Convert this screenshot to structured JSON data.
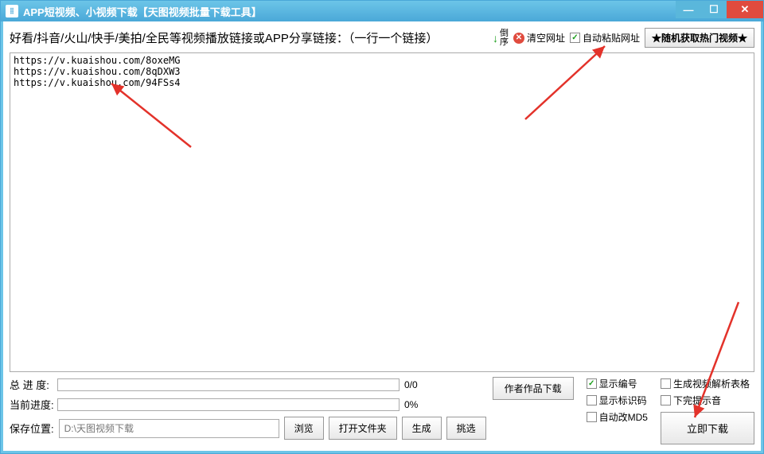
{
  "titlebar": {
    "icon": "⦙⦙",
    "text": "APP短视频、小视频下载【天图视频批量下载工具】"
  },
  "instruction": "好看/抖音/火山/快手/美拍/全民等视频播放链接或APP分享链接：（一行一个链接）",
  "reverse_label": "倒\n序",
  "clear_label": "清空网址",
  "autopaste_label": "自动粘贴网址",
  "star_label": "★随机获取热门视频★",
  "urls": "https://v.kuaishou.com/8oxeMG\nhttps://v.kuaishou.com/8qDXW3\nhttps://v.kuaishou.com/94FSs4",
  "progress": {
    "total_label": "总 进 度:",
    "total_text": "0/0",
    "current_label": "当前进度:",
    "current_text": "0%"
  },
  "buttons": {
    "author": "作者作品下载",
    "browse": "浏览",
    "openfolder": "打开文件夹",
    "generate": "生成",
    "pick": "挑选",
    "download": "立即下载"
  },
  "checkboxes": {
    "show_number": "显示编号",
    "show_id": "显示标识码",
    "auto_md5": "自动改MD5",
    "gen_table": "生成视频解析表格",
    "sound": "下完提示音"
  },
  "save": {
    "label": "保存位置:",
    "placeholder": "D:\\天图视频下载"
  }
}
